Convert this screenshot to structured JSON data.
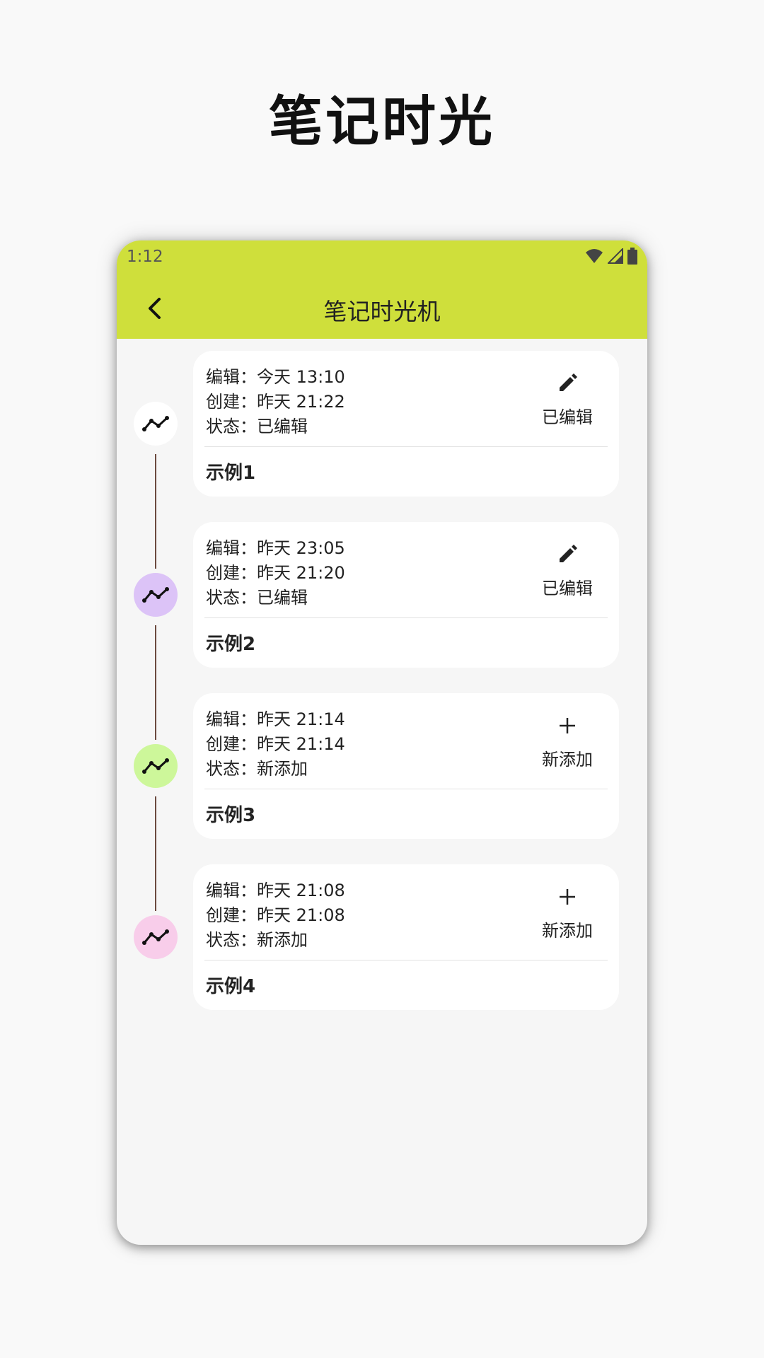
{
  "promo": {
    "title": "笔记时光"
  },
  "status_bar": {
    "time": "1:12",
    "icons": [
      "wifi-icon",
      "cell-signal-icon",
      "battery-icon"
    ]
  },
  "app_bar": {
    "title": "笔记时光机",
    "back_icon": "chevron-left-icon",
    "color": "#cfdf3b"
  },
  "entries": [
    {
      "edit_line": "编辑：今天 13:10",
      "create_line": "创建：昨天 21:22",
      "status_line": "状态：已编辑",
      "status_label": "已编辑",
      "status_icon": "pencil-icon",
      "title": "示例1",
      "dot_color": "#ffffff",
      "dot_icon": "trend-line-icon"
    },
    {
      "edit_line": "编辑：昨天 23:05",
      "create_line": "创建：昨天 21:20",
      "status_line": "状态：已编辑",
      "status_label": "已编辑",
      "status_icon": "pencil-icon",
      "title": "示例2",
      "dot_color": "#dcc3f7",
      "dot_icon": "trend-line-icon"
    },
    {
      "edit_line": "编辑：昨天 21:14",
      "create_line": "创建：昨天 21:14",
      "status_line": "状态：新添加",
      "status_label": "新添加",
      "status_icon": "plus-icon",
      "title": "示例3",
      "dot_color": "#cdf79a",
      "dot_icon": "trend-line-icon"
    },
    {
      "edit_line": "编辑：昨天 21:08",
      "create_line": "创建：昨天 21:08",
      "status_line": "状态：新添加",
      "status_label": "新添加",
      "status_icon": "plus-icon",
      "title": "示例4",
      "dot_color": "#f8cdea",
      "dot_icon": "trend-line-icon"
    }
  ]
}
